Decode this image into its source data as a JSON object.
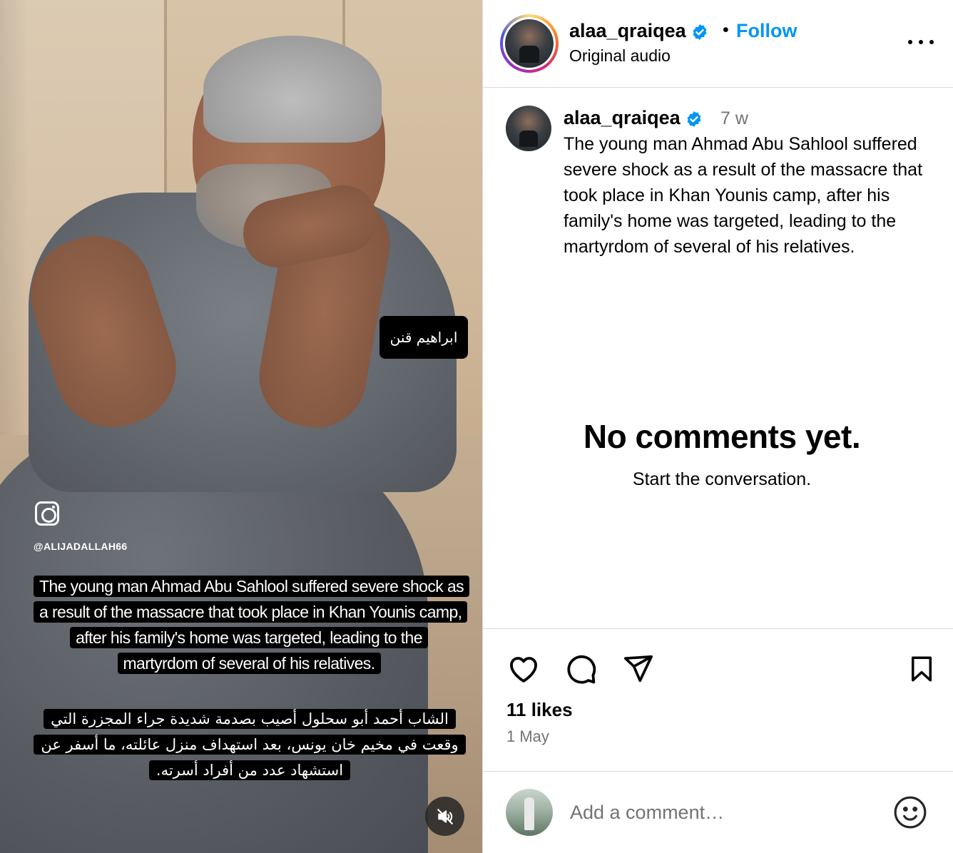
{
  "video": {
    "name_tag": "ابراهيم قنن",
    "watermark_handle": "@ALIJADALLAH66",
    "subtitle_en": "The young man Ahmad Abu Sahlool suffered severe shock as a result of the massacre that took place in Khan Younis camp, after his family's home was targeted, leading to the martyrdom of several of his relatives.",
    "subtitle_ar": "الشاب أحمد أبو سحلول أصيب بصدمة شديدة جراء المجزرة التي وقعت في مخيم خان يونس، بعد استهداف منزل عائلته، ما أسفر عن استشهاد عدد من أفراد أسرته.",
    "mute_icon": "muted-speaker-icon"
  },
  "header": {
    "username": "alaa_qraiqea",
    "separator": "•",
    "follow_label": "Follow",
    "audio_label": "Original audio",
    "more_icon": "more-options-icon"
  },
  "caption": {
    "username": "alaa_qraiqea",
    "time": "7 w",
    "text": "The young man Ahmad Abu Sahlool suffered severe shock as a result of the massacre that took place in Khan Younis camp, after his family's home was targeted, leading to the martyrdom of several of his relatives."
  },
  "comments": {
    "empty_title": "No comments yet.",
    "empty_subtitle": "Start the conversation."
  },
  "actions": {
    "icons": [
      "heart-icon",
      "comment-icon",
      "share-icon",
      "bookmark-icon"
    ],
    "likes": "11 likes",
    "date": "1 May"
  },
  "add_comment": {
    "placeholder": "Add a comment…",
    "emoji_icon": "emoji-icon"
  },
  "colors": {
    "accent": "#0095f6",
    "verified": "#0095f6",
    "secondary_text": "#737373",
    "divider": "#dbdbdb"
  }
}
